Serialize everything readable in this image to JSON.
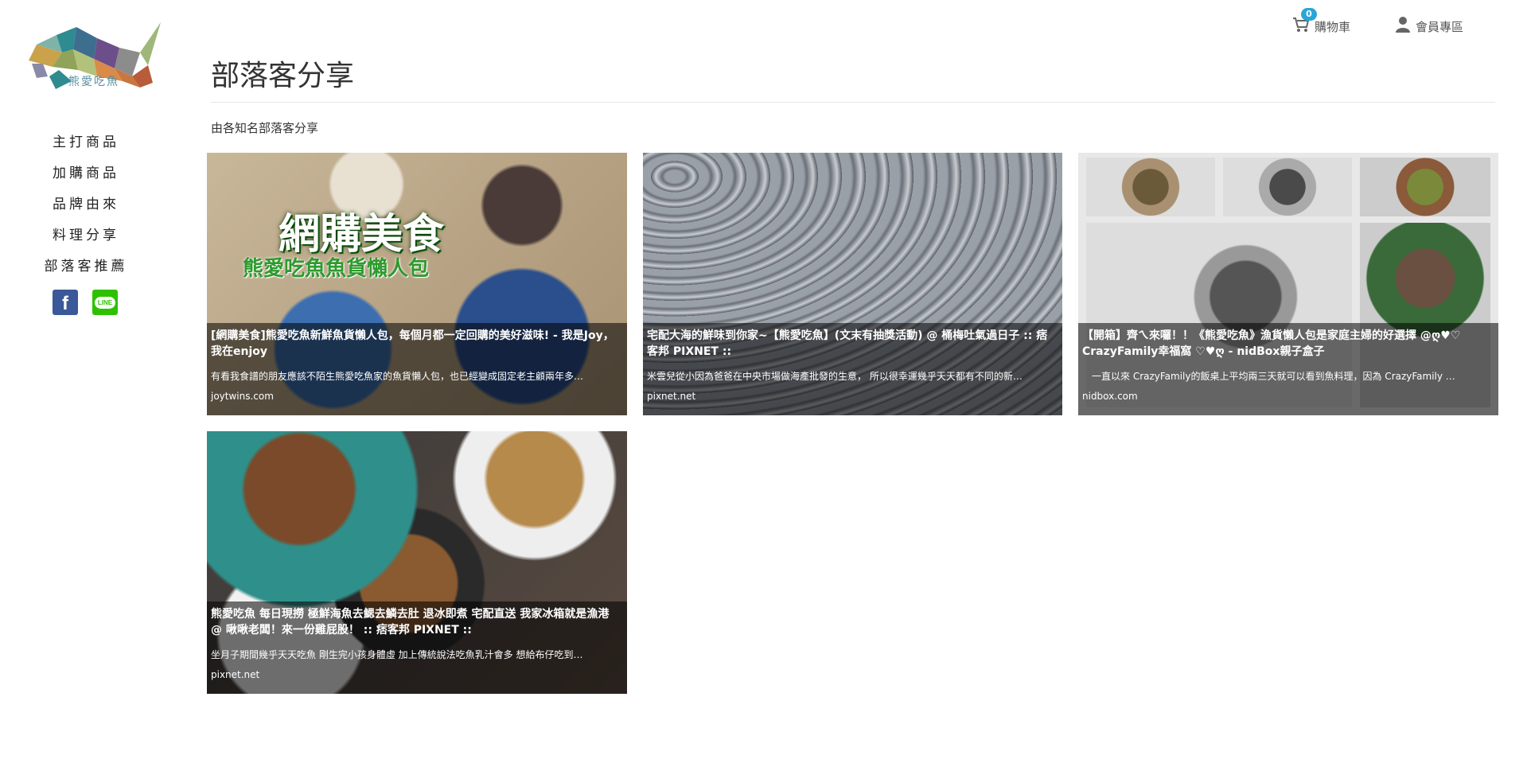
{
  "sidebar": {
    "logo_text": "熊愛吃魚",
    "nav": [
      {
        "label": "主打商品"
      },
      {
        "label": "加購商品"
      },
      {
        "label": "品牌由來"
      },
      {
        "label": "料理分享"
      },
      {
        "label": "部落客推薦"
      }
    ],
    "social": {
      "facebook_glyph": "f",
      "line_label": "LINE"
    }
  },
  "header": {
    "cart_label": "購物車",
    "cart_count": "0",
    "member_label": "會員專區"
  },
  "main": {
    "title": "部落客分享",
    "subtitle": "由各知名部落客分享",
    "cards": [
      {
        "image_headline": "網購美食",
        "image_subheadline": "熊愛吃魚魚貨懶人包",
        "title": "[網購美食]熊愛吃魚新鮮魚貨懶人包，每個月都一定回購的美好滋味! - 我是Joy，我在enjoy",
        "desc": "有看我食譜的朋友應該不陌生熊愛吃魚家的魚貨懶人包，也已經變成固定老主顧兩年多…",
        "domain": "joytwins.com"
      },
      {
        "title": "宅配大海的鮮味到你家~【熊愛吃魚】(文末有抽獎活動) @ 桶梅吐氣過日子 :: 痞客邦 PIXNET ::",
        "desc": "米雲兒從小因為爸爸在中央市場做海產批發的生意， 所以很幸運幾乎天天都有不同的新…",
        "domain": "pixnet.net"
      },
      {
        "title": "【開箱】齊ㄟ來囉！！《熊愛吃魚》漁貨懶人包是家庭主婦的好選擇 @ღ♥♡ CrazyFamily幸福窩 ♡♥ღ - nidBox親子盒子",
        "desc": "　一直以來 CrazyFamily的飯桌上平均兩三天就可以看到魚料理，因為 CrazyFamily …",
        "domain": "nidbox.com"
      },
      {
        "title": "熊愛吃魚 每日現撈 極鮮海魚去鰓去鱗去肚 退冰即煮 宅配直送 我家冰箱就是漁港 @ 啾啾老闆！來一份雞屁股！ :: 痞客邦 PIXNET ::",
        "desc": "坐月子期間幾乎天天吃魚 剛生完小孩身體虛 加上傳統說法吃魚乳汁會多 想給布仔吃到…",
        "domain": "pixnet.net"
      }
    ]
  },
  "colors": {
    "accent": "#2ba5d8",
    "facebook": "#3b5998",
    "line": "#2dc100"
  }
}
